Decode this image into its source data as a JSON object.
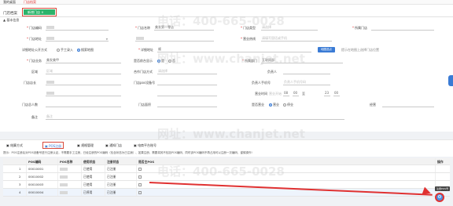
{
  "topbar": {
    "home": "我的桌面",
    "tab": "门店档案"
  },
  "breadcrumb": "门店档案",
  "new_button": "新增门店 ×",
  "section_title": "▲ 基本信息",
  "watermark": {
    "phone": "电话：400-665-0028",
    "site": "网址：www.chanjet.net"
  },
  "form": {
    "r1": {
      "code_label": "门店编码",
      "name_label": "门店名称",
      "name_value": "美发第一零店",
      "type_label": "门店类型",
      "type_placeholder": "请选择",
      "org_label": "所属门店",
      "org_value": ""
    },
    "r2": {
      "addr_label": "门店地址",
      "phone_label": "营业热线",
      "phone_placeholder": "请填写固话或手机"
    },
    "r3": {
      "locate_label": "详细地址公开方式",
      "radio1": "手工录入",
      "radio2": "搜索地图",
      "detail_label": "详细地址",
      "detail_value": "顺",
      "locate_btn": "地图选点",
      "locate_tip": "提示在地图上选择门店位置"
    },
    "r4": {
      "cat_label": "门店业务",
      "cat_value": "美发美甲",
      "show_label": "是否前台显示",
      "yes": "是",
      "no": "否",
      "dept_label": "所属部门",
      "dept_value": "互联网部"
    },
    "r5": {
      "area_label": "区域",
      "area_placeholder": "区域",
      "shop_label": "合作门店方式",
      "shop_placeholder": "请选择",
      "person_label": "负责人",
      "person_value": ""
    },
    "r6": {
      "mgr_label": "门店店长",
      "pos_label": "门店pos设备号",
      "person2_label": "负责人手机号",
      "person2_placeholder": "负责人手机号码"
    },
    "r7": {
      "days_label": "营业时间",
      "start_placeholder": "营业开始",
      "h1": "08",
      "m1": "00",
      "to": "至",
      "h2": "23",
      "m2": "00"
    },
    "r8": {
      "sales_label": "门店总人数",
      "area2_label": "门店面积",
      "plat_label": "是否营业",
      "plat_yes": "营业",
      "plat_no": "停业",
      "remark2_label": "经营"
    },
    "r9": {
      "remark_label": "备注",
      "remark_placeholder": "备注"
    }
  },
  "tabs": [
    "结算方式",
    "POS注册",
    "规格管理",
    "通知门店",
    "电商平台账号"
  ],
  "tip": "提示：POS注册后对POS设备号进行注册认证，不需要手工注册，已经注册的POS编码（包含状态为已注销）、如果注册，需要将其不包括POS编码，同时该POS编码不再占用可以注册一次编码，谨慎操作!",
  "table": {
    "headers": [
      "",
      "POS编码",
      "POS名称",
      "使用状态",
      "注册状态",
      "是否主POS",
      "",
      "操作"
    ],
    "rows": [
      {
        "no": "1",
        "code": "00010001",
        "status": "已使用",
        "reg": "已注册"
      },
      {
        "no": "2",
        "code": "00010002",
        "status": "已使用",
        "reg": "已注册"
      },
      {
        "no": "3",
        "code": "00010003",
        "status": "已使用",
        "reg": "已注册"
      },
      {
        "no": "4",
        "code": "00010004",
        "status": "已停用",
        "reg": "已注册"
      }
    ]
  },
  "tooltip": "注册POS号",
  "action_icon": "register-icon"
}
